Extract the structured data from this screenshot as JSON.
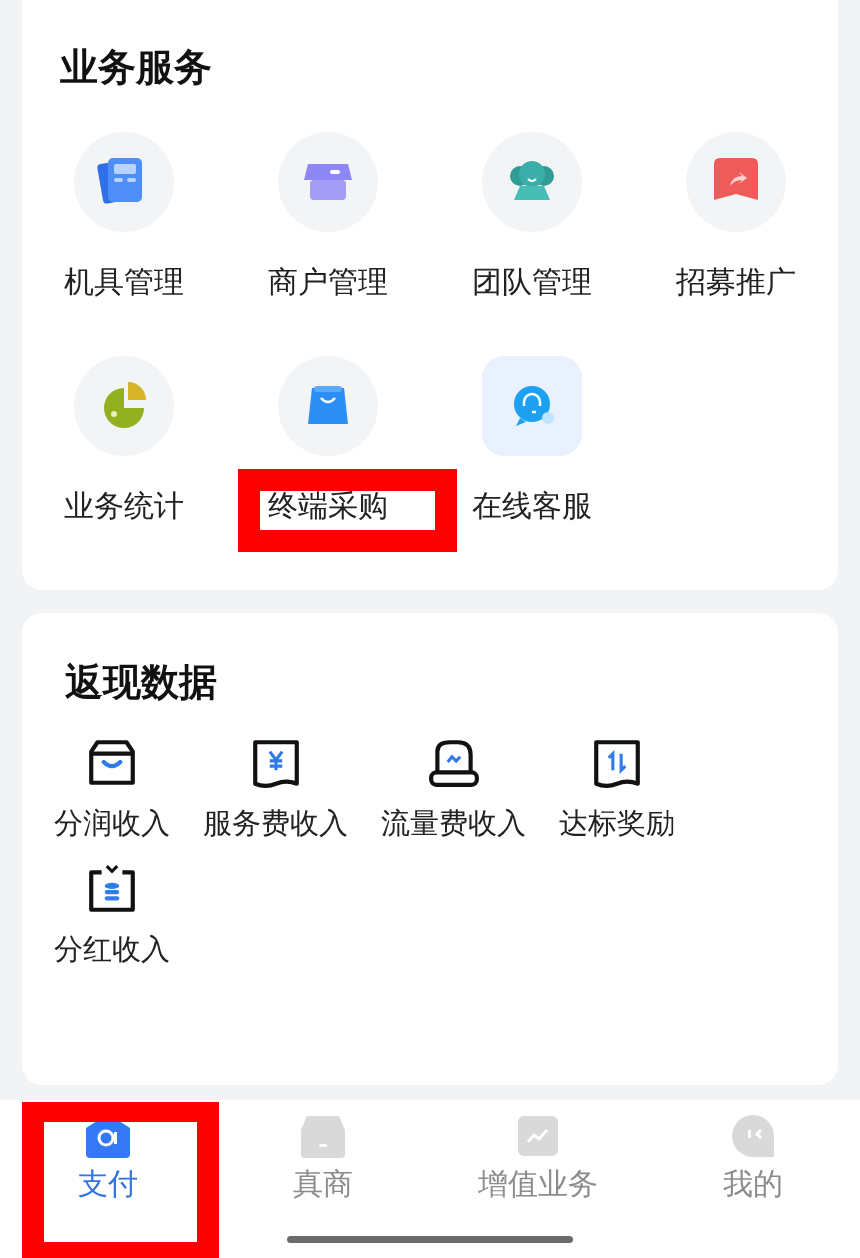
{
  "business_services": {
    "title": "业务服务",
    "items": [
      {
        "label": "机具管理",
        "kind": "device",
        "highlighted": false
      },
      {
        "label": "商户管理",
        "kind": "store",
        "highlighted": false
      },
      {
        "label": "团队管理",
        "kind": "team",
        "highlighted": false
      },
      {
        "label": "招募推广",
        "kind": "share",
        "highlighted": false
      },
      {
        "label": "业务统计",
        "kind": "pie",
        "highlighted": false
      },
      {
        "label": "终端采购",
        "kind": "bag",
        "highlighted": true
      },
      {
        "label": "在线客服",
        "kind": "support",
        "highlighted": false
      }
    ]
  },
  "cashback_data": {
    "title": "返现数据",
    "items": [
      {
        "label": "分润收入",
        "kind": "box"
      },
      {
        "label": "服务费收入",
        "kind": "yen"
      },
      {
        "label": "流量费收入",
        "kind": "terminal"
      },
      {
        "label": "达标奖励",
        "kind": "transfer"
      },
      {
        "label": "分红收入",
        "kind": "coins"
      }
    ]
  },
  "tab_bar": [
    {
      "label": "支付",
      "kind": "pay",
      "selected": true,
      "highlighted": true
    },
    {
      "label": "真商",
      "kind": "shop",
      "selected": false,
      "highlighted": false
    },
    {
      "label": "增值业务",
      "kind": "chart",
      "selected": false,
      "highlighted": false
    },
    {
      "label": "我的",
      "kind": "me",
      "selected": false,
      "highlighted": false
    }
  ]
}
